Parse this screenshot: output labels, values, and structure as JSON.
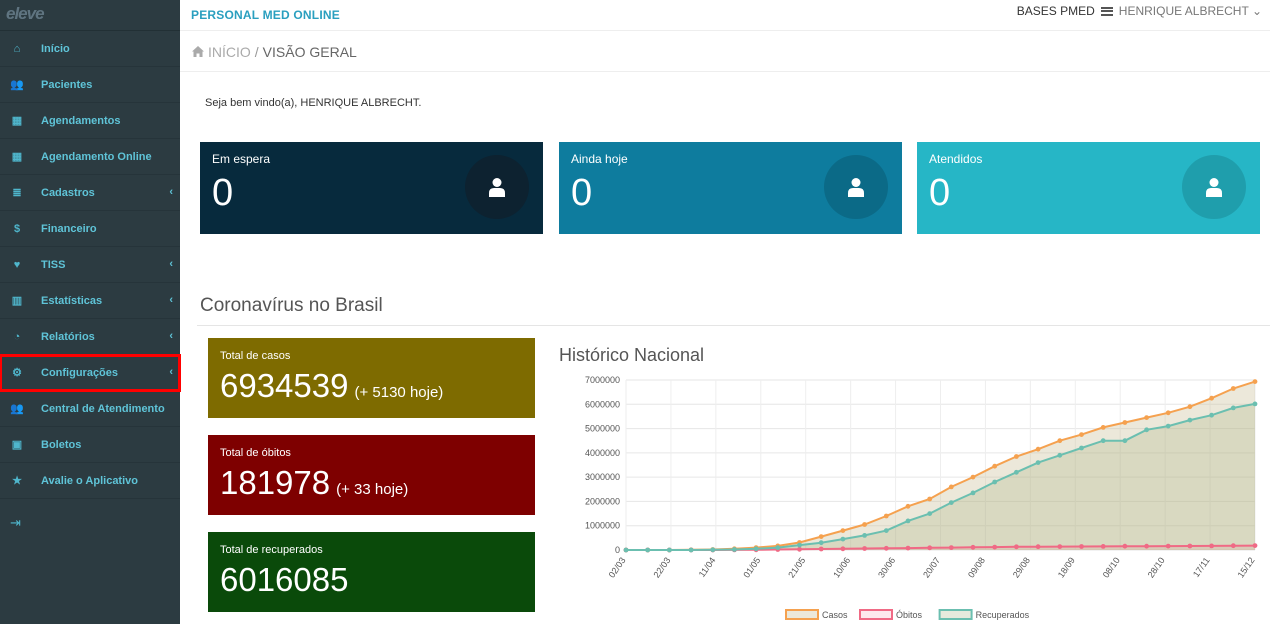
{
  "colors": {
    "sidebar": "#2c3b41",
    "accent": "#2a9fbf",
    "card_waiting": "#072a3d",
    "card_today": "#0e7c9e",
    "card_done": "#26b6c6",
    "cases_box": "#7e6b00",
    "deaths_box": "#7e0000",
    "recovered_box": "#0a4a0a",
    "casos_line": "#f5a14f",
    "obitos_line": "#f06a85",
    "recuperados_line": "#6bbfb0"
  },
  "sidebar": {
    "logo": "eleve",
    "items": [
      {
        "label": "Início",
        "icon": "home-icon",
        "chevron": false
      },
      {
        "label": "Pacientes",
        "icon": "users-icon",
        "chevron": false
      },
      {
        "label": "Agendamentos",
        "icon": "calendar-icon",
        "chevron": false
      },
      {
        "label": "Agendamento Online",
        "icon": "calendar-icon",
        "chevron": false
      },
      {
        "label": "Cadastros",
        "icon": "list-icon",
        "chevron": true
      },
      {
        "label": "Financeiro",
        "icon": "dollar-icon",
        "chevron": false
      },
      {
        "label": "TISS",
        "icon": "heartbeat-icon",
        "chevron": true
      },
      {
        "label": "Estatísticas",
        "icon": "bar-chart-icon",
        "chevron": true
      },
      {
        "label": "Relatórios",
        "icon": "pie-chart-icon",
        "chevron": true
      },
      {
        "label": "Configurações",
        "icon": "gear-icon",
        "chevron": true
      },
      {
        "label": "Central de Atendimento",
        "icon": "users-icon",
        "chevron": false
      },
      {
        "label": "Boletos",
        "icon": "money-icon",
        "chevron": false
      },
      {
        "label": "Avalie o Aplicativo",
        "icon": "star-icon",
        "chevron": false
      }
    ],
    "chevron_glyph": "‹",
    "collapse_glyph": "⇥"
  },
  "header": {
    "brand": "PERSONAL MED ONLINE",
    "bases_label": "BASES PMED",
    "user_name": "HENRIQUE ALBRECHT",
    "user_caret": "⌄"
  },
  "breadcrumb": {
    "home": "INÍCIO",
    "separator": "/",
    "current": "VISÃO GERAL"
  },
  "welcome": "Seja bem vindo(a), HENRIQUE ALBRECHT.",
  "cards": [
    {
      "title": "Em espera",
      "value": "0"
    },
    {
      "title": "Ainda hoje",
      "value": "0"
    },
    {
      "title": "Atendidos",
      "value": "0"
    }
  ],
  "covid": {
    "section_title": "Coronavírus no Brasil",
    "cases": {
      "title": "Total de casos",
      "value": "6934539",
      "today": "(+ 5130 hoje)"
    },
    "deaths": {
      "title": "Total de óbitos",
      "value": "181978",
      "today": "(+ 33 hoje)"
    },
    "recovered": {
      "title": "Total de recuperados",
      "value": "6016085"
    }
  },
  "chart_title": "Histórico Nacional",
  "chart_data": {
    "type": "line",
    "title": "Histórico Nacional",
    "x_tick_labels": [
      "02/03",
      "22/03",
      "11/04",
      "01/05",
      "21/05",
      "10/06",
      "30/06",
      "20/07",
      "09/08",
      "29/08",
      "18/09",
      "08/10",
      "28/10",
      "17/11",
      "15/12"
    ],
    "y_tick_labels": [
      "0",
      "1000000",
      "2000000",
      "3000000",
      "4000000",
      "5000000",
      "6000000",
      "7000000"
    ],
    "ylim": [
      0,
      7000000
    ],
    "grid": true,
    "legend_position": "bottom",
    "series": [
      {
        "name": "Casos",
        "values": [
          0,
          0,
          1000,
          10000,
          20000,
          50000,
          100000,
          170000,
          310000,
          550000,
          800000,
          1050000,
          1400000,
          1800000,
          2100000,
          2600000,
          3000000,
          3450000,
          3850000,
          4150000,
          4500000,
          4750000,
          5050000,
          5250000,
          5450000,
          5650000,
          5900000,
          6250000,
          6650000,
          6934539
        ]
      },
      {
        "name": "Óbitos",
        "values": [
          0,
          0,
          0,
          500,
          2000,
          5000,
          10000,
          20000,
          30000,
          40000,
          50000,
          60000,
          70000,
          80000,
          90000,
          100000,
          110000,
          120000,
          130000,
          135000,
          140000,
          145000,
          150000,
          155000,
          158000,
          162000,
          166000,
          170000,
          176000,
          181978
        ]
      },
      {
        "name": "Recuperados",
        "values": [
          0,
          0,
          0,
          2000,
          8000,
          20000,
          50000,
          100000,
          200000,
          300000,
          450000,
          600000,
          800000,
          1200000,
          1500000,
          1950000,
          2350000,
          2800000,
          3200000,
          3600000,
          3900000,
          4200000,
          4500000,
          4500000,
          4950000,
          5100000,
          5350000,
          5550000,
          5850000,
          6016085
        ]
      }
    ]
  }
}
